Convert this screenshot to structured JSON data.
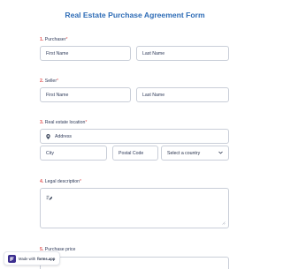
{
  "form": {
    "title": "Real Estate Purchase Agreement Form"
  },
  "purchaser": {
    "number": "1.",
    "label": "Purchaser",
    "required_mark": "*",
    "first_placeholder": "First Name",
    "last_placeholder": "Last Name"
  },
  "seller": {
    "number": "2.",
    "label": "Seller",
    "required_mark": "*",
    "first_placeholder": "First Name",
    "last_placeholder": "Last Name"
  },
  "location": {
    "number": "3.",
    "label": "Real estate location",
    "required_mark": "*",
    "address_placeholder": "Address",
    "address_icon": "map-pin-icon",
    "city_placeholder": "City",
    "postal_placeholder": "Postal Code",
    "country_value": "Select a country",
    "country_icon": "chevron-down-icon"
  },
  "legal": {
    "number": "4.",
    "label": "Legal description",
    "required_mark": "*",
    "edit_icon": "text-edit-icon"
  },
  "price": {
    "number": "5.",
    "label": "Purchase price"
  },
  "badge": {
    "prefix": "Made with",
    "brand": "forms.app",
    "logo_icon": "forms-app-logo-icon"
  },
  "colors": {
    "title": "#2e6cb6",
    "required": "#e25454",
    "border": "#c9ced8"
  }
}
